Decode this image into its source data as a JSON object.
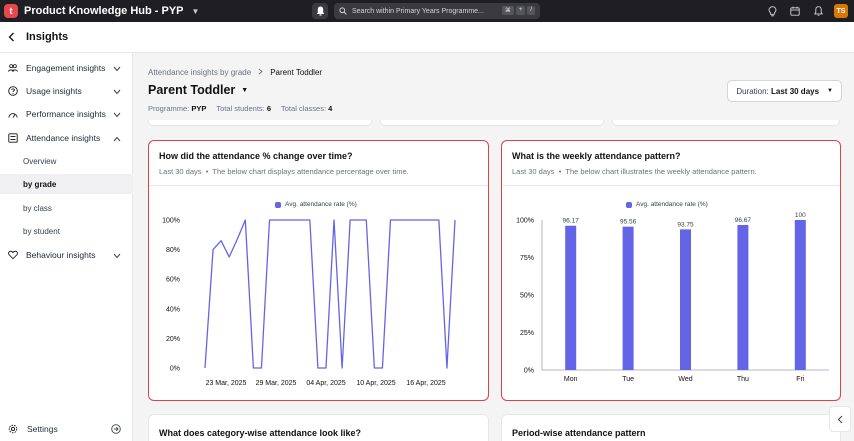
{
  "app": {
    "logo_letter": "t",
    "title": "Product Knowledge Hub - PYP",
    "search_placeholder": "Search within Primary Years Programme...",
    "shortcut": [
      "⌘",
      "+",
      "/"
    ],
    "avatar_initials": "TS"
  },
  "header": {
    "title": "Insights"
  },
  "sidebar": {
    "items": [
      {
        "label": "Engagement insights",
        "icon": "people-icon"
      },
      {
        "label": "Usage insights",
        "icon": "question-icon"
      },
      {
        "label": "Performance insights",
        "icon": "gauge-icon"
      },
      {
        "label": "Attendance insights",
        "icon": "clipboard-icon"
      },
      {
        "label": "Behaviour insights",
        "icon": "heart-icon"
      }
    ],
    "attendance_sub": [
      "Overview",
      "by grade",
      "by class",
      "by student"
    ],
    "settings_label": "Settings"
  },
  "breadcrumb": {
    "parent": "Attendance insights by grade",
    "current": "Parent Toddler"
  },
  "page": {
    "title": "Parent Toddler",
    "programme_label": "Programme:",
    "programme_value": "PYP",
    "students_label": "Total students:",
    "students_value": "6",
    "classes_label": "Total classes:",
    "classes_value": "4",
    "duration_label": "Duration:",
    "duration_value": "Last 30 days"
  },
  "cards": {
    "trend": {
      "title": "How did the attendance % change over time?",
      "period": "Last 30 days",
      "desc": "The below chart displays attendance percentage over time.",
      "legend": "Avg. attendance rate (%)"
    },
    "weekly": {
      "title": "What is the weekly attendance pattern?",
      "period": "Last 30 days",
      "desc": "The below chart illustrates the weekly attendance pattern.",
      "legend": "Avg. attendance rate (%)"
    },
    "category": {
      "title": "What does category-wise attendance look like?"
    },
    "period": {
      "title": "Period-wise attendance pattern"
    }
  },
  "colors": {
    "series": "#6464e6",
    "highlight": "#d9434b"
  },
  "chart_data": [
    {
      "type": "line",
      "series": [
        {
          "name": "Avg. attendance rate (%)",
          "values": [
            0,
            80,
            86,
            75,
            87,
            100,
            0,
            0,
            100,
            100,
            100,
            100,
            100,
            100,
            0,
            0,
            100,
            0,
            100,
            100,
            100,
            0,
            0,
            100,
            100,
            100,
            100,
            100,
            100,
            100,
            0,
            100
          ]
        }
      ],
      "xticks": [
        "23 Mar, 2025",
        "29 Mar, 2025",
        "04 Apr, 2025",
        "10 Apr, 2025",
        "16 Apr, 2025"
      ],
      "yticks": [
        "0%",
        "20%",
        "40%",
        "60%",
        "80%",
        "100%"
      ],
      "ylim": [
        0,
        100
      ],
      "legend": "top-center",
      "grid": false
    },
    {
      "type": "bar",
      "categories": [
        "Mon",
        "Tue",
        "Wed",
        "Thu",
        "Fri"
      ],
      "series": [
        {
          "name": "Avg. attendance rate (%)",
          "values": [
            96.17,
            95.56,
            93.75,
            96.67,
            100
          ]
        }
      ],
      "value_labels": [
        "96.17",
        "95.56",
        "93.75",
        "96.67",
        "100"
      ],
      "yticks": [
        "0%",
        "25%",
        "50%",
        "75%",
        "100%"
      ],
      "ylim": [
        0,
        100
      ],
      "legend": "top-center",
      "grid": false
    }
  ]
}
